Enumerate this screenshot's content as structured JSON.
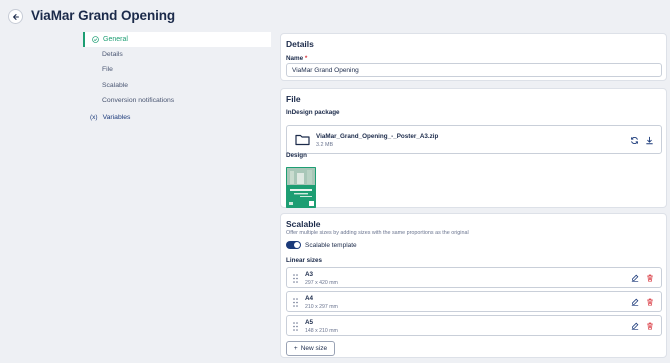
{
  "header": {
    "title": "ViaMar Grand Opening"
  },
  "sidebar": {
    "items": [
      {
        "label": "General"
      },
      {
        "label": "Details"
      },
      {
        "label": "File"
      },
      {
        "label": "Scalable"
      },
      {
        "label": "Conversion notifications"
      }
    ],
    "variables_label": "Variables",
    "variables_icon_text": "(x)"
  },
  "details": {
    "title": "Details",
    "name_label": "Name",
    "name_required_mark": "*",
    "name_value": "ViaMar Grand Opening"
  },
  "file": {
    "title": "File",
    "indesign_label": "InDesign package",
    "file_name": "ViaMar_Grand_Opening_-_Poster_A3.zip",
    "file_size": "3.2 MB",
    "design_label": "Design"
  },
  "scalable": {
    "title": "Scalable",
    "description": "Offer multiple sizes by adding sizes with the same proportions as the original",
    "toggle_label": "Scalable template",
    "toggle_on": true,
    "linear_sizes_label": "Linear sizes",
    "sizes": [
      {
        "name": "A3",
        "dims": "297 x 420 mm"
      },
      {
        "name": "A4",
        "dims": "210 x 297 mm"
      },
      {
        "name": "A5",
        "dims": "148 x 210 mm"
      }
    ],
    "new_size_label": "New size",
    "new_size_prefix": "+"
  },
  "colors": {
    "accent": "#1d9e73",
    "primary": "#1b3a7a",
    "danger": "#d9363e",
    "background": "#eef0f4"
  }
}
